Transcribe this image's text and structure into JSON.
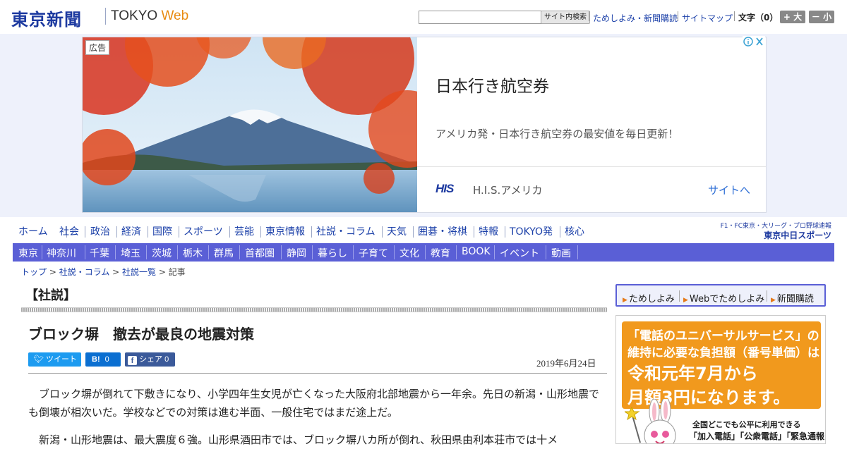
{
  "header": {
    "logo": "東京新聞",
    "logo_tokyo": "TOKYO",
    "logo_web": "Web",
    "search_button": "サイト内検索",
    "links": [
      "ためしよみ・新聞購読",
      "サイトマップ"
    ],
    "font_size_label": "文字（0）",
    "font_bigger": "+ 大",
    "font_smaller": "－ 小"
  },
  "ad": {
    "badge": "広告",
    "title": "日本行き航空券",
    "description": "アメリカ発・日本行き航空券の最安値を毎日更新！",
    "brand_logo": "HIS",
    "advertiser": "H.I.S.アメリカ",
    "cta": "サイトへ"
  },
  "nav_primary": [
    "ホーム",
    "社会",
    "政治",
    "経済",
    "国際",
    "スポーツ",
    "芸能",
    "東京情報",
    "社説・コラム",
    "天気",
    "囲碁・将棋",
    "特報",
    "TOKYO発",
    "核心"
  ],
  "partner": {
    "line1": "F1・FC東京・大リーグ・プロ野球速報",
    "line2": "東京中日スポーツ"
  },
  "nav_secondary": [
    "東京",
    "神奈川",
    "千葉",
    "埼玉",
    "茨城",
    "栃木",
    "群馬",
    "首都圏",
    "静岡",
    "暮らし",
    "子育て",
    "文化",
    "教育",
    "BOOK",
    "イベント",
    "動画"
  ],
  "breadcrumb": [
    "トップ",
    "社説・コラム",
    "社説一覧",
    "記事"
  ],
  "article": {
    "section": "【社説】",
    "title": "ブロック塀　撤去が最良の地震対策",
    "share": {
      "tweet": "ツイート",
      "hatena": "B!",
      "hatena_count": "0",
      "facebook": "シェア",
      "facebook_count": "0"
    },
    "date": "2019年6月24日",
    "paragraphs": [
      "ブロック塀が倒れて下敷きになり、小学四年生女児が亡くなった大阪府北部地震から一年余。先日の新潟・山形地震でも倒壊が相次いだ。学校などでの対策は進む半面、一般住宅ではまだ途上だ。",
      "新潟・山形地震は、最大震度６強。山形県酒田市では、ブロック塀八カ所が倒れ、秋田県由利本荘市では十メ"
    ]
  },
  "rail": {
    "links": [
      "ためしよみ",
      "Webでためしよみ",
      "新聞購読"
    ],
    "uni_ad": {
      "line1": "「電話のユニバーサルサービス」の",
      "line2": "維持に必要な負担額（番号単価）は",
      "line3": "令和元年7月から",
      "line4": "月額3円になります。",
      "sub1": "全国どこでも公平に利用できる",
      "sub2": "「加入電話」「公衆電話」「緊急通報"
    }
  },
  "colors": {
    "brand_blue": "#1d3aa0",
    "nav_bar": "#5a5fd6",
    "link": "#1a3fa8",
    "accent_orange": "#f1991d"
  }
}
